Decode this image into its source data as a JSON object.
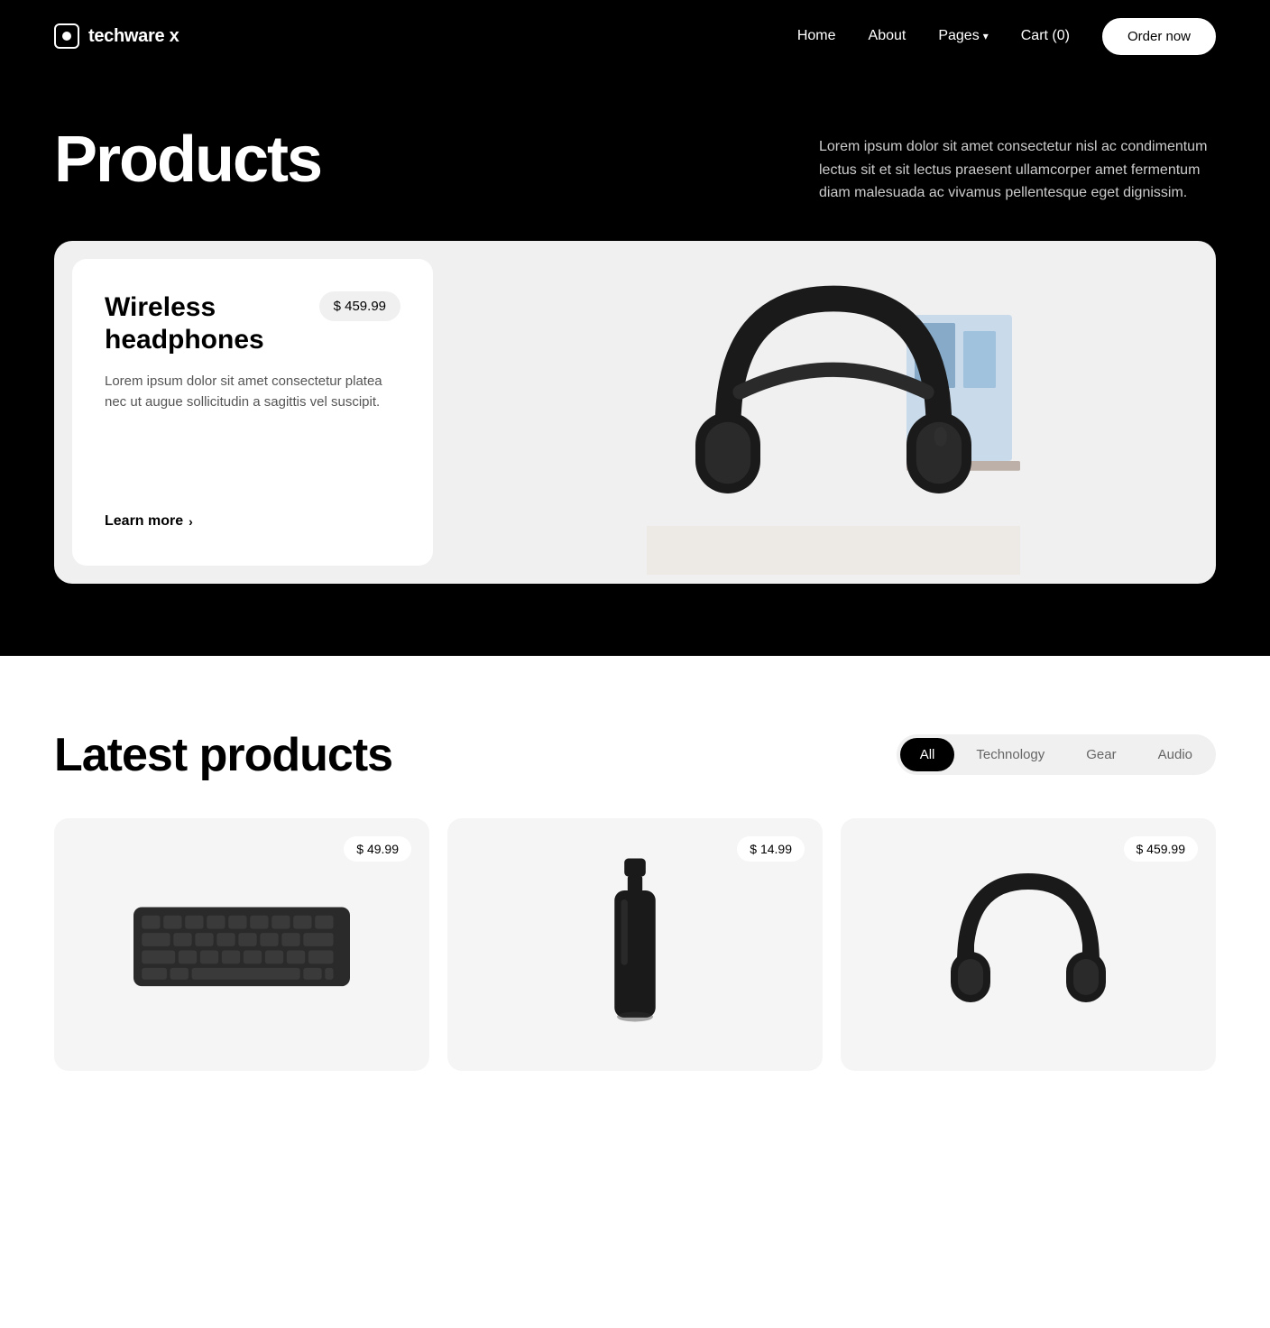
{
  "header": {
    "logo_text": "techware x",
    "nav": {
      "home": "Home",
      "about": "About",
      "pages": "Pages",
      "cart": "Cart (0)",
      "order_btn": "Order now"
    }
  },
  "hero": {
    "title": "Products",
    "description": "Lorem ipsum dolor sit amet consectetur nisl ac condimentum lectus sit et sit lectus praesent ullamcorper amet fermentum diam malesuada ac vivamus pellentesque eget dignissim."
  },
  "featured_product": {
    "name": "Wireless headphones",
    "price": "$ 459.99",
    "description": "Lorem ipsum dolor sit amet consectetur platea nec ut augue sollicitudin a sagittis vel suscipit.",
    "learn_more": "Learn more"
  },
  "latest_section": {
    "title": "Latest products",
    "filters": [
      {
        "label": "All",
        "active": true
      },
      {
        "label": "Technology",
        "active": false
      },
      {
        "label": "Gear",
        "active": false
      },
      {
        "label": "Audio",
        "active": false
      }
    ]
  },
  "products": [
    {
      "price": "$ 49.99",
      "type": "keyboard"
    },
    {
      "price": "$ 14.99",
      "type": "bottle"
    },
    {
      "price": "$ 459.99",
      "type": "headphones"
    }
  ],
  "colors": {
    "black": "#000000",
    "white": "#ffffff",
    "light_gray": "#f0f0f0",
    "mid_gray": "#f5f5f5",
    "text_gray": "#555555"
  }
}
